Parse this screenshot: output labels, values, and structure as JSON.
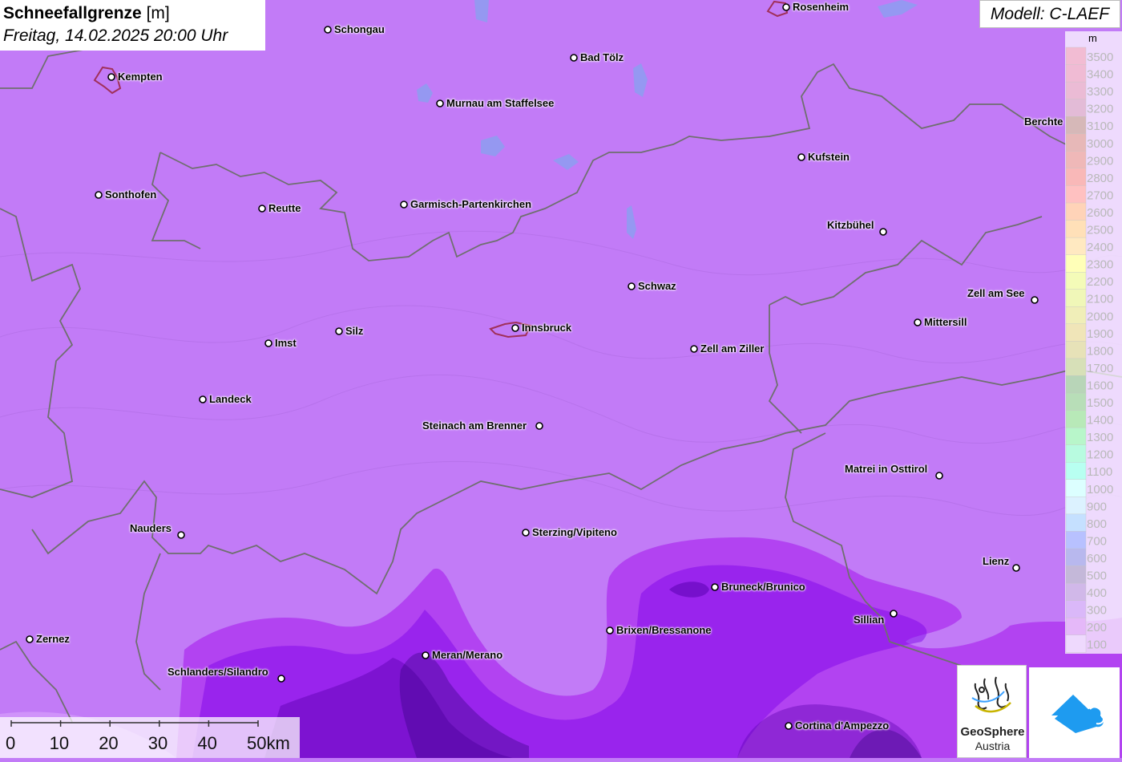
{
  "title": {
    "variable": "Schneefallgrenze",
    "unit": "[m]",
    "datetime": "Freitag, 14.02.2025 20:00 Uhr"
  },
  "model": "Modell: C-LAEF",
  "legend": {
    "unit": "m",
    "entries": [
      {
        "label": "3500",
        "color": "#d01060"
      },
      {
        "label": "3400",
        "color": "#c80e64"
      },
      {
        "label": "3300",
        "color": "#b80c6a"
      },
      {
        "label": "3200",
        "color": "#9c0c70"
      },
      {
        "label": "3100",
        "color": "#6b0000"
      },
      {
        "label": "3000",
        "color": "#a80000"
      },
      {
        "label": "2900",
        "color": "#c40000"
      },
      {
        "label": "2800",
        "color": "#e80000"
      },
      {
        "label": "2700",
        "color": "#ff2020"
      },
      {
        "label": "2600",
        "color": "#ff6000"
      },
      {
        "label": "2500",
        "color": "#ff9000"
      },
      {
        "label": "2400",
        "color": "#ffb020"
      },
      {
        "label": "2300",
        "color": "#ffff00"
      },
      {
        "label": "2200",
        "color": "#d8f000"
      },
      {
        "label": "2100",
        "color": "#c8e000"
      },
      {
        "label": "2000",
        "color": "#c8c000"
      },
      {
        "label": "1900",
        "color": "#c8a000"
      },
      {
        "label": "1800",
        "color": "#a89800"
      },
      {
        "label": "1700",
        "color": "#709000"
      },
      {
        "label": "1600",
        "color": "#006800"
      },
      {
        "label": "1500",
        "color": "#008800"
      },
      {
        "label": "1400",
        "color": "#00b000"
      },
      {
        "label": "1300",
        "color": "#00dd40"
      },
      {
        "label": "1200",
        "color": "#00f090"
      },
      {
        "label": "1100",
        "color": "#00ffcc"
      },
      {
        "label": "1000",
        "color": "#80ffff"
      },
      {
        "label": "900",
        "color": "#80d0ff"
      },
      {
        "label": "800",
        "color": "#3090ff"
      },
      {
        "label": "700",
        "color": "#0020ff"
      },
      {
        "label": "600",
        "color": "#0000c0"
      },
      {
        "label": "500",
        "color": "#2e0078"
      },
      {
        "label": "400",
        "color": "#5a00b0"
      },
      {
        "label": "300",
        "color": "#7a00e8"
      },
      {
        "label": "200",
        "color": "#a000e8"
      },
      {
        "label": "100",
        "color": "#c278f7"
      }
    ]
  },
  "cities": [
    {
      "name": "Rosenheim"
    },
    {
      "name": "Schongau"
    },
    {
      "name": "Kempten"
    },
    {
      "name": "Bad Tölz"
    },
    {
      "name": "Murnau am Staffelsee"
    },
    {
      "name": "Berchte"
    },
    {
      "name": "Kufstein"
    },
    {
      "name": "Sonthofen"
    },
    {
      "name": "Reutte"
    },
    {
      "name": "Garmisch-Partenkirchen"
    },
    {
      "name": "Kitzbühel"
    },
    {
      "name": "Schwaz"
    },
    {
      "name": "Zell am See"
    },
    {
      "name": "Mittersill"
    },
    {
      "name": "Silz"
    },
    {
      "name": "Innsbruck"
    },
    {
      "name": "Imst"
    },
    {
      "name": "Zell am Ziller"
    },
    {
      "name": "Landeck"
    },
    {
      "name": "Steinach am Brenner"
    },
    {
      "name": "Matrei in Osttirol"
    },
    {
      "name": "Nauders"
    },
    {
      "name": "Sterzing/Vipiteno"
    },
    {
      "name": "Lienz"
    },
    {
      "name": "Bruneck/Brunico"
    },
    {
      "name": "Sillian"
    },
    {
      "name": "Brixen/Bressanone"
    },
    {
      "name": "Zernez"
    },
    {
      "name": "Meran/Merano"
    },
    {
      "name": "Schlanders/Silandro"
    },
    {
      "name": "Cortina d'Ampezzo"
    }
  ],
  "scale_bar": {
    "labels": [
      "0",
      "10",
      "20",
      "30",
      "40",
      "50km"
    ]
  },
  "logos": {
    "geosphere_line1": "GeoSphere",
    "geosphere_line2": "Austria",
    "app_icon": "cloud-arrow-icon"
  }
}
